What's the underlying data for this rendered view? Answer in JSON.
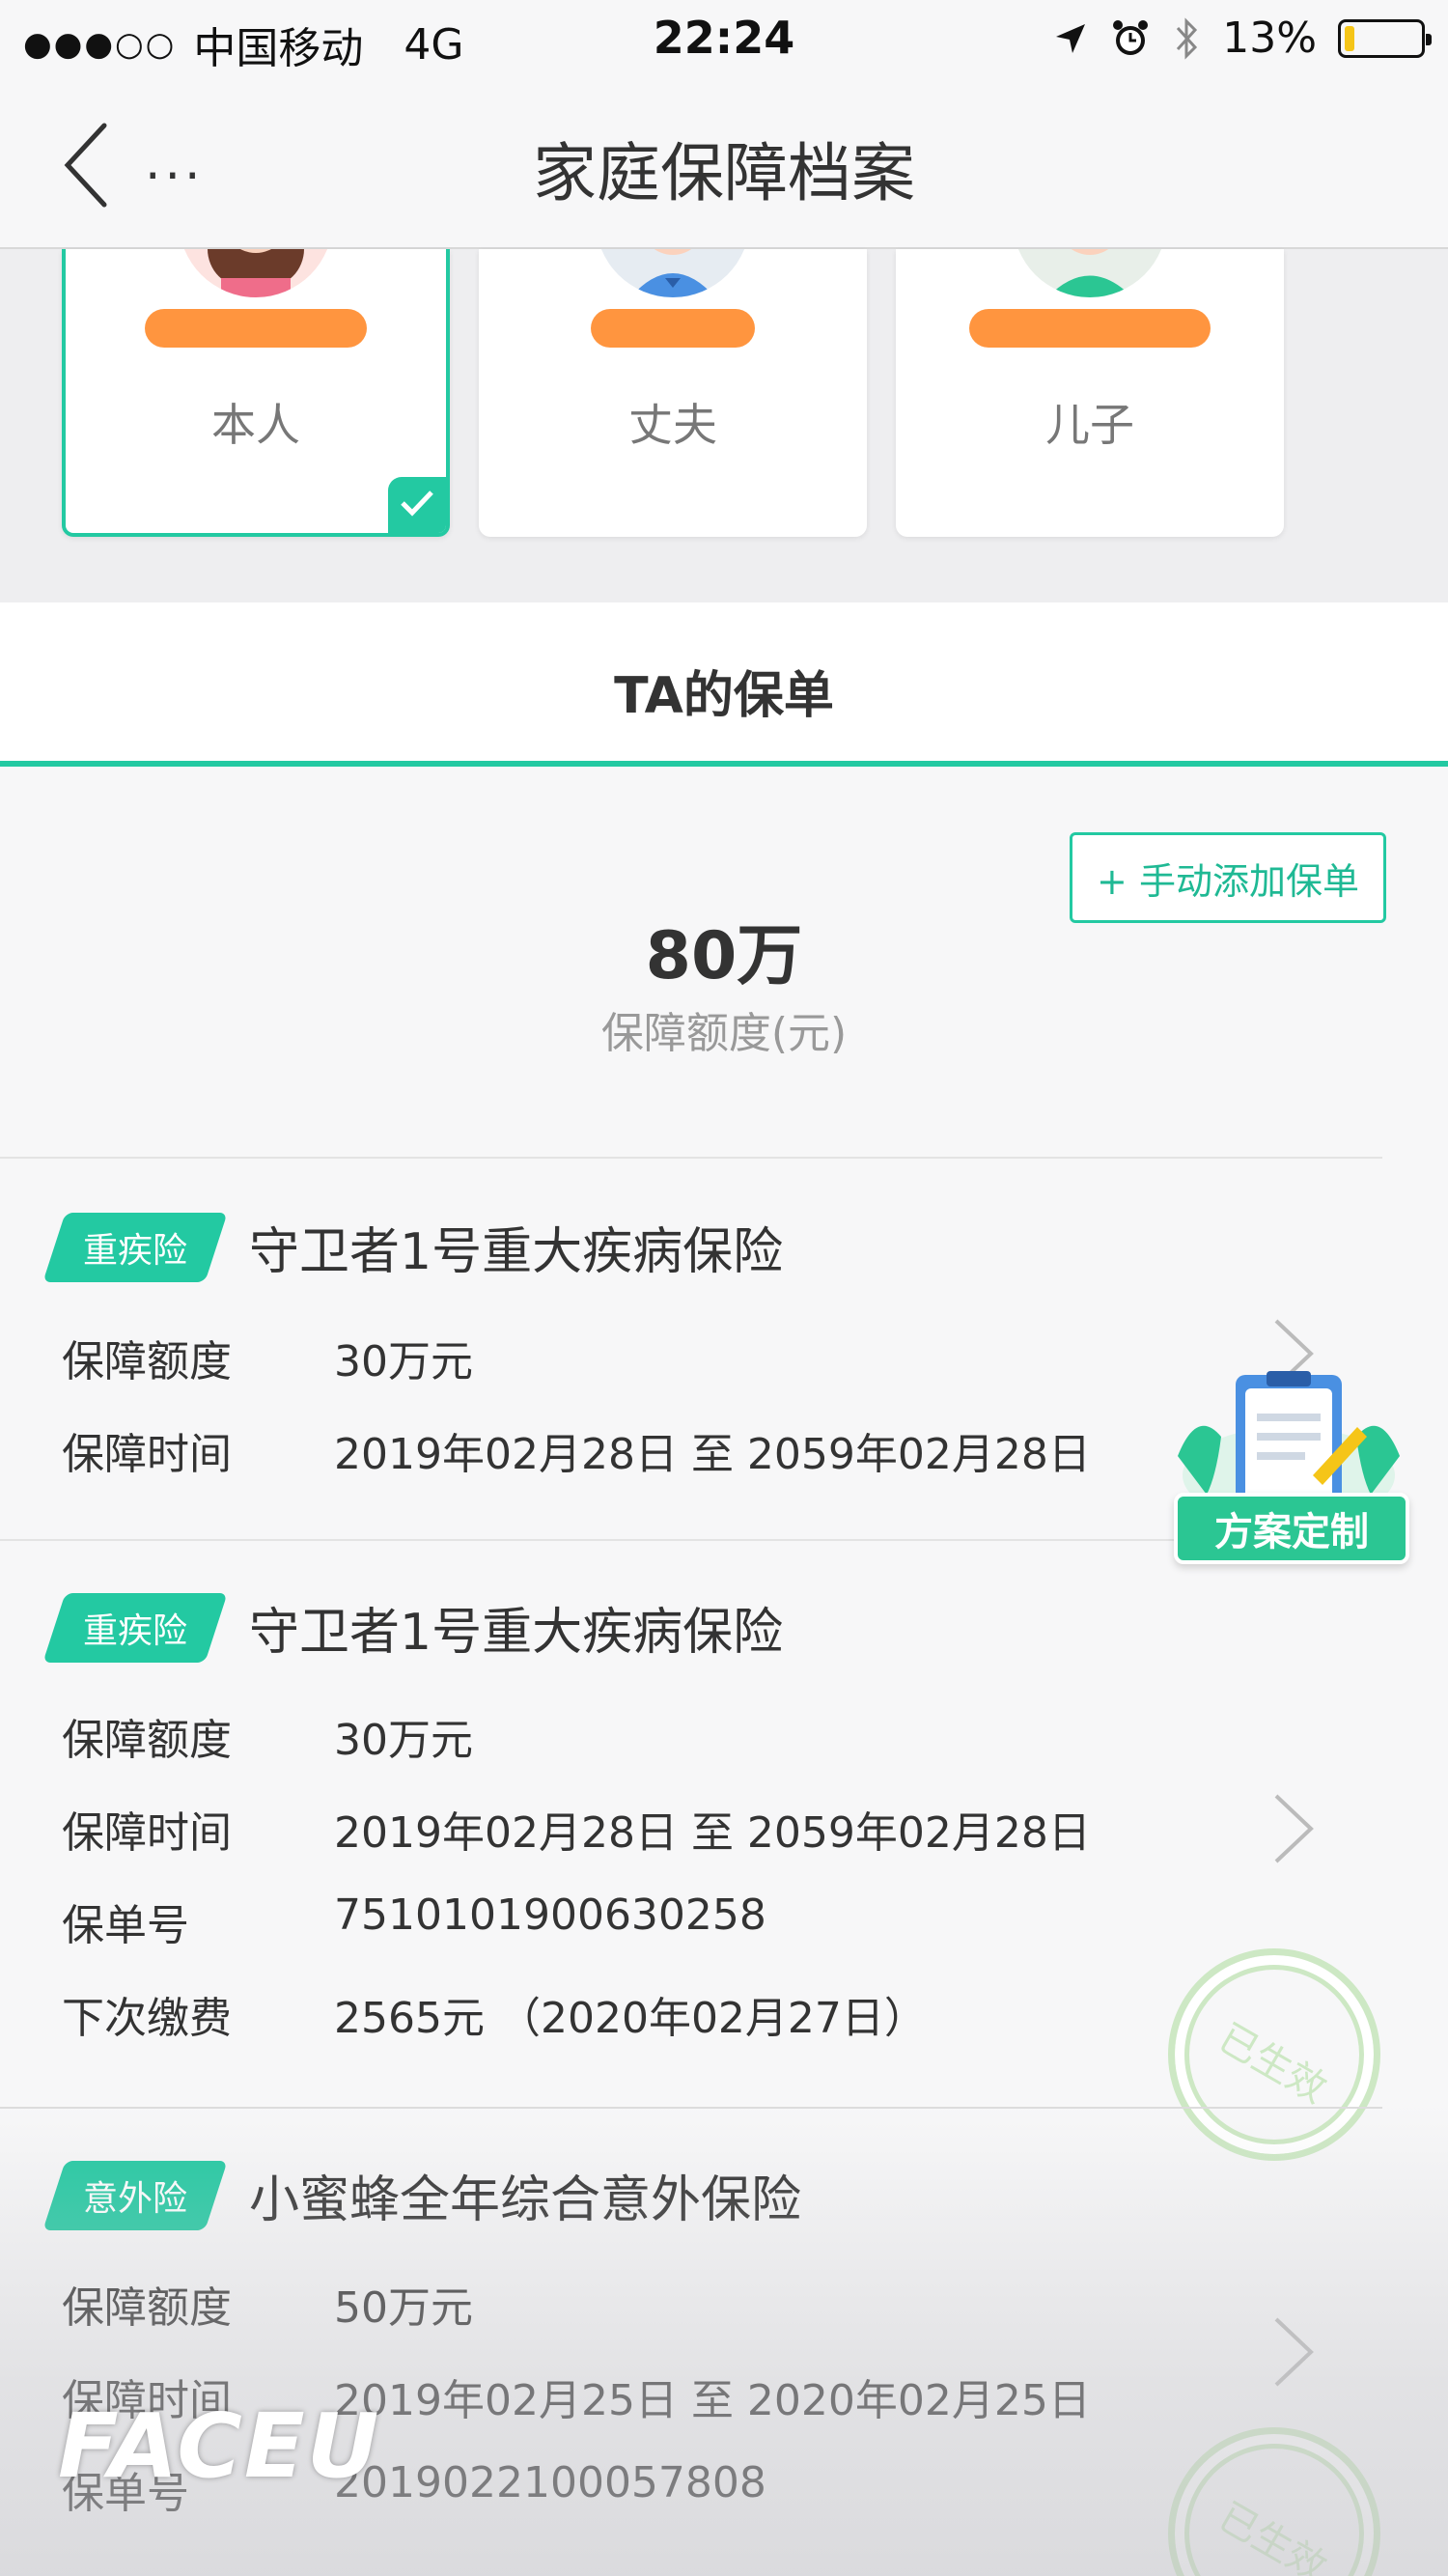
{
  "status_bar": {
    "signal": "●●●○○",
    "carrier": "中国移动",
    "network": "4G",
    "time": "22:24",
    "battery_pct": "13%",
    "battery_level": 0.13
  },
  "nav": {
    "title": "家庭保障档案",
    "more": "..."
  },
  "members": [
    {
      "role": "本人",
      "selected": true
    },
    {
      "role": "丈夫",
      "selected": false
    },
    {
      "role": "儿子",
      "selected": false
    }
  ],
  "tab": {
    "title": "TA的保单"
  },
  "summary": {
    "add_button": "+ 手动添加保单",
    "total": "80万",
    "total_label": "保障额度(元)"
  },
  "policies": [
    {
      "tag": "重疾险",
      "name": "守卫者1号重大疾病保险",
      "rows": [
        {
          "k": "保障额度",
          "v": "30万元"
        },
        {
          "k": "保障时间",
          "v": "2019年02月28日 至 2059年02月28日"
        }
      ]
    },
    {
      "tag": "重疾险",
      "name": "守卫者1号重大疾病保险",
      "rows": [
        {
          "k": "保障额度",
          "v": "30万元"
        },
        {
          "k": "保障时间",
          "v": "2019年02月28日 至 2059年02月28日"
        },
        {
          "k": "保单号",
          "v": "7510101900630258"
        },
        {
          "k": "下次缴费",
          "v": "2565元 （2020年02月27日）"
        }
      ],
      "stamp": "已生效"
    },
    {
      "tag": "意外险",
      "name": "小蜜蜂全年综合意外保险",
      "rows": [
        {
          "k": "保障额度",
          "v": "50万元"
        },
        {
          "k": "保障时间",
          "v": "2019年02月25日 至 2020年02月25日"
        },
        {
          "k": "保单号",
          "v": "2019022100057808"
        }
      ],
      "stamp": "已生效"
    }
  ],
  "fab": {
    "label": "方案定制"
  },
  "watermark": "FACEU",
  "colors": {
    "accent": "#23c9a2",
    "redaction": "#ff8a2a"
  }
}
